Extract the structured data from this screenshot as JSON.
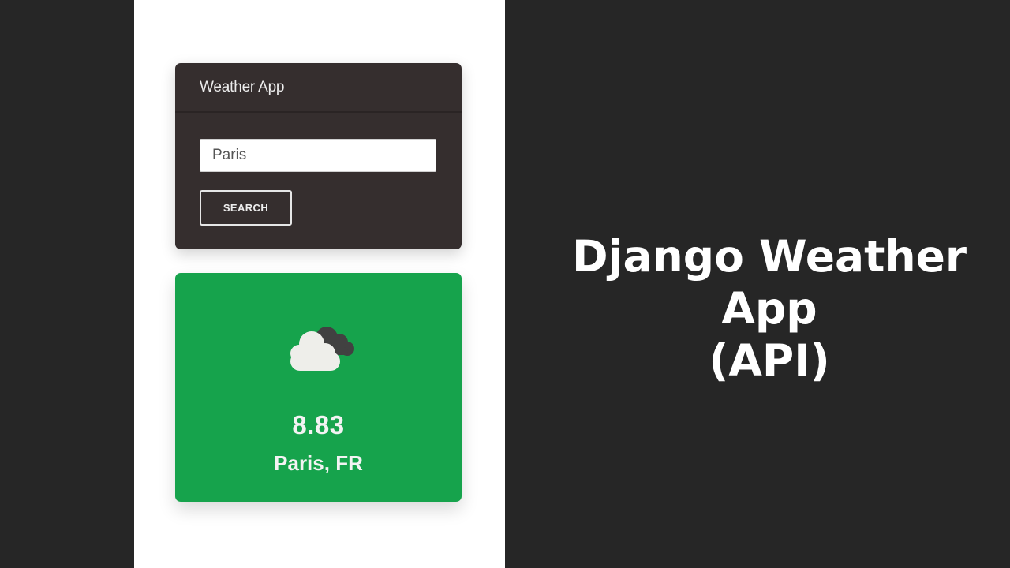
{
  "app": {
    "title": "Weather App"
  },
  "search": {
    "value": "Paris",
    "button_label": "SEARCH"
  },
  "result": {
    "icon": "broken-clouds-icon",
    "temperature": "8.83",
    "location": "Paris, FR"
  },
  "headline": {
    "line1": "Django Weather App",
    "line2": "(API)"
  },
  "colors": {
    "page_bg": "#262626",
    "card_bg": "#352e2e",
    "result_bg": "#16a34c",
    "text_light": "#f3f3f3"
  }
}
